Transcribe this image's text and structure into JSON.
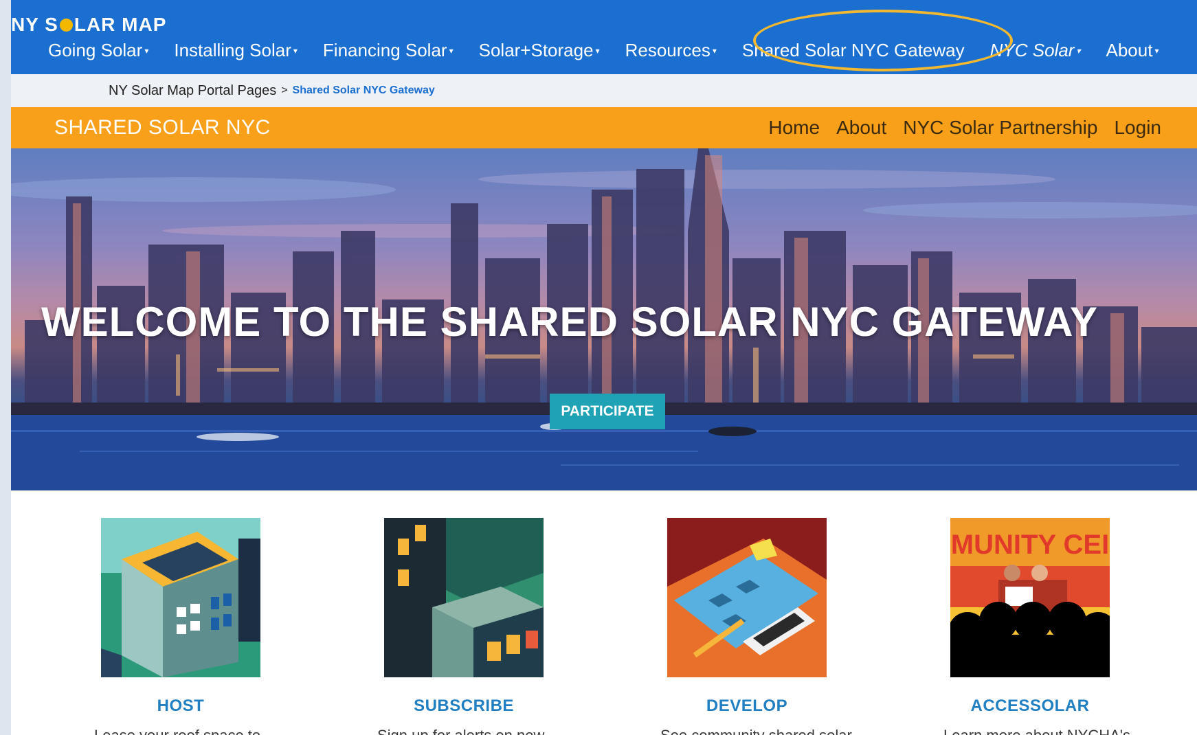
{
  "brand": {
    "prefix": "NY S",
    "suffix": "LAR MAP"
  },
  "topnav": {
    "items": [
      {
        "label": "Going Solar",
        "caret": "▾",
        "italic": false
      },
      {
        "label": "Installing Solar",
        "caret": "▾",
        "italic": false
      },
      {
        "label": "Financing Solar",
        "caret": "▾",
        "italic": false
      },
      {
        "label": "Solar+Storage",
        "caret": "▾",
        "italic": false
      },
      {
        "label": "Resources",
        "caret": "▾",
        "italic": false
      },
      {
        "label": "Shared Solar NYC Gateway",
        "caret": "",
        "italic": false
      },
      {
        "label": "NYC Solar",
        "caret": "▾",
        "italic": true
      },
      {
        "label": "About",
        "caret": "▾",
        "italic": false
      }
    ],
    "highlight_color": "#f2b830"
  },
  "breadcrumb": {
    "parent": "NY Solar Map Portal Pages",
    "separator": ">",
    "current": "Shared Solar NYC Gateway"
  },
  "site_bar": {
    "title": "SHARED SOLAR NYC",
    "links": [
      "Home",
      "About",
      "NYC Solar Partnership",
      "Login"
    ]
  },
  "hero": {
    "title": "WELCOME TO THE SHARED SOLAR NYC GATEWAY",
    "button": "PARTICIPATE"
  },
  "cards": [
    {
      "title": "HOST",
      "desc": "Lease your roof space to",
      "icon": "rooftop-solar-building-icon"
    },
    {
      "title": "SUBSCRIBE",
      "desc": "Sign up for alerts on new",
      "icon": "apartment-windows-icon"
    },
    {
      "title": "DEVELOP",
      "desc": "See community shared solar",
      "icon": "blueprint-phone-icon"
    },
    {
      "title": "ACCESSOLAR",
      "desc": "Learn more about NYCHA's",
      "icon": "community-center-audience-icon"
    }
  ],
  "card_image_texts": {
    "accessolar_sign": "MUNITY CEI"
  },
  "colors": {
    "nav_blue": "#1a6fd0",
    "site_orange": "#f9a01b",
    "button_teal": "#1fa3b4",
    "card_title_blue": "#1f7fc2"
  }
}
